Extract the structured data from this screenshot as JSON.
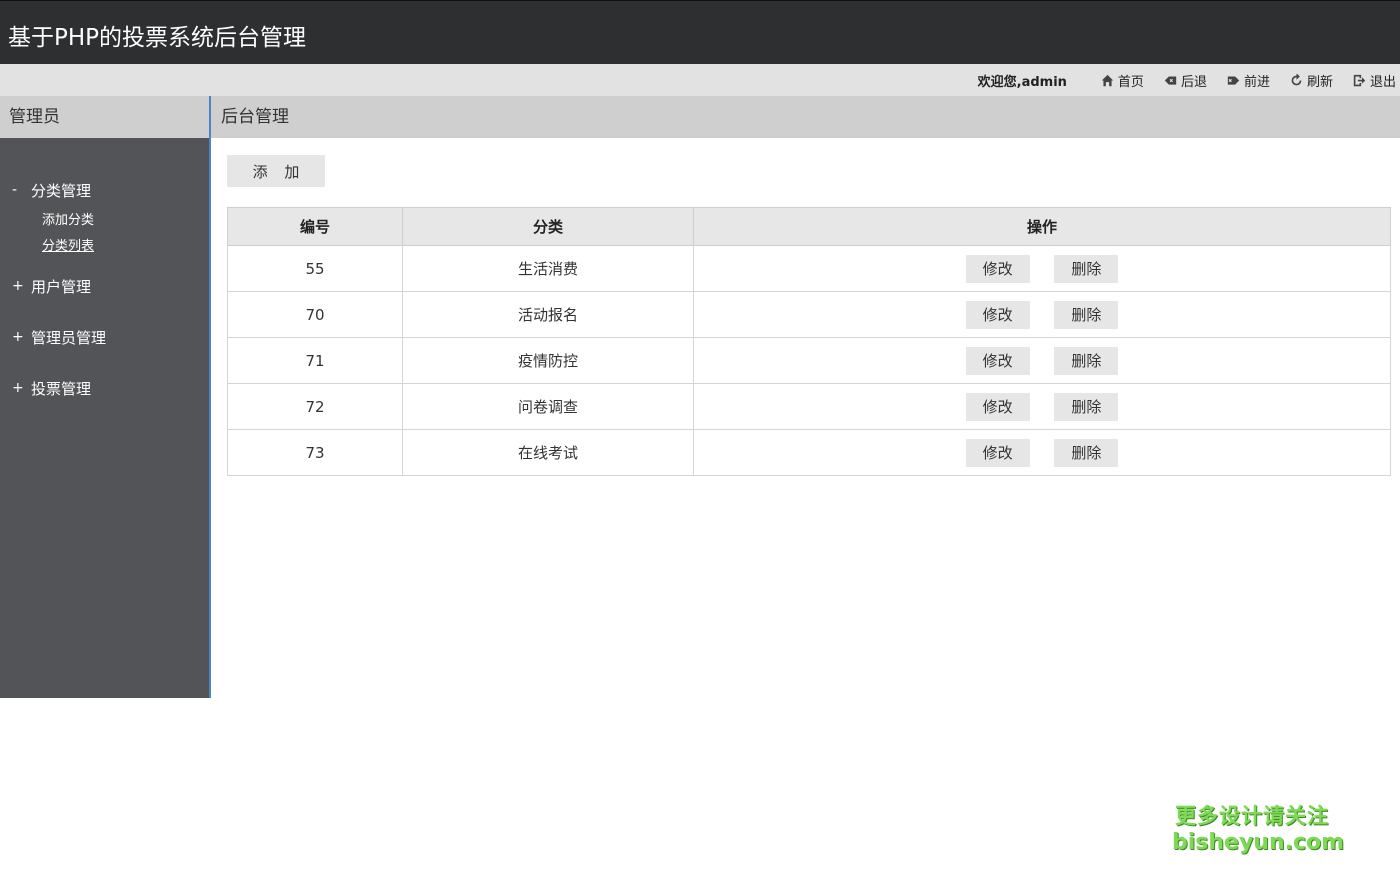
{
  "header": {
    "title": "基于PHP的投票系统后台管理"
  },
  "topbar": {
    "welcome": "欢迎您,admin",
    "nav": [
      {
        "label": "首页",
        "icon": "home-icon"
      },
      {
        "label": "后退",
        "icon": "back-icon"
      },
      {
        "label": "前进",
        "icon": "forward-icon"
      },
      {
        "label": "刷新",
        "icon": "refresh-icon"
      },
      {
        "label": "退出",
        "icon": "logout-icon"
      }
    ]
  },
  "sidebar": {
    "title": "管理员",
    "groups": [
      {
        "sign": "-",
        "label": "分类管理",
        "items": [
          {
            "label": "添加分类"
          },
          {
            "label": "分类列表"
          }
        ]
      },
      {
        "sign": "+",
        "label": "用户管理"
      },
      {
        "sign": "+",
        "label": "管理员管理"
      },
      {
        "sign": "+",
        "label": "投票管理"
      }
    ]
  },
  "main": {
    "title": "后台管理",
    "add_label": "添 加",
    "table": {
      "headers": [
        "编号",
        "分类",
        "操作"
      ],
      "edit_label": "修改",
      "delete_label": "删除",
      "rows": [
        {
          "id": "55",
          "category": "生活消费"
        },
        {
          "id": "70",
          "category": "活动报名"
        },
        {
          "id": "71",
          "category": "疫情防控"
        },
        {
          "id": "72",
          "category": "问卷调查"
        },
        {
          "id": "73",
          "category": "在线考试"
        }
      ]
    }
  },
  "watermark": {
    "line1": "更多设计请关注",
    "line2": "bisheyun.com"
  },
  "colors": {
    "header_bg": "#2e2f31",
    "sidebar_bg": "#525457",
    "accent_line": "#4a86c7",
    "watermark": "#7ed957"
  }
}
